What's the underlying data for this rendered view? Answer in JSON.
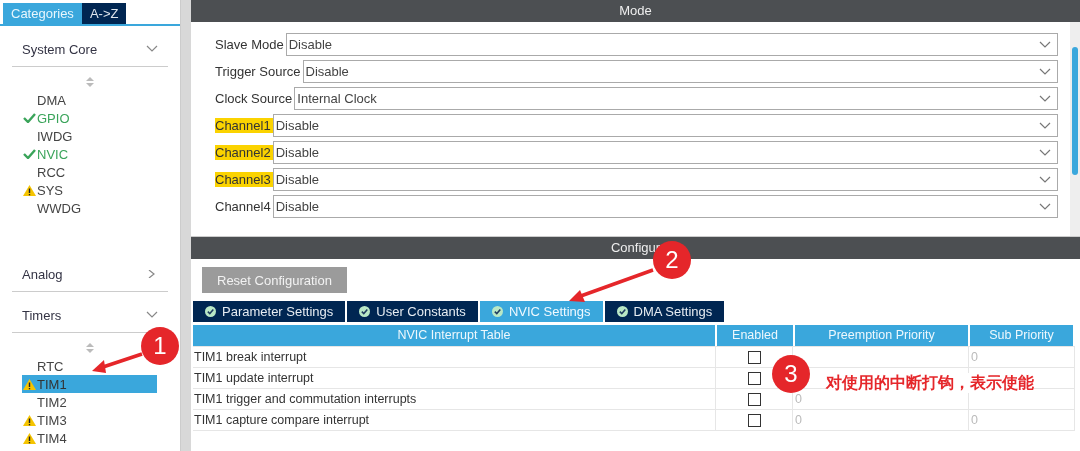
{
  "sidebar": {
    "tabs": [
      {
        "label": "Categories",
        "selected": true
      },
      {
        "label": "A->Z",
        "selected": false
      }
    ],
    "groups": [
      {
        "title": "System Core",
        "expanded": true,
        "items": [
          {
            "label": "DMA",
            "kind": "plain",
            "selected": false
          },
          {
            "label": "GPIO",
            "kind": "ok",
            "selected": false
          },
          {
            "label": "IWDG",
            "kind": "plain",
            "selected": false
          },
          {
            "label": "NVIC",
            "kind": "ok",
            "selected": false
          },
          {
            "label": "RCC",
            "kind": "plain",
            "selected": false
          },
          {
            "label": "SYS",
            "kind": "warning",
            "selected": false
          },
          {
            "label": "WWDG",
            "kind": "plain",
            "selected": false
          }
        ]
      },
      {
        "title": "Analog",
        "expanded": false
      },
      {
        "title": "Timers",
        "expanded": true,
        "items": [
          {
            "label": "RTC",
            "kind": "plain",
            "selected": false
          },
          {
            "label": "TIM1",
            "kind": "warning",
            "selected": true
          },
          {
            "label": "TIM2",
            "kind": "plain",
            "selected": false
          },
          {
            "label": "TIM3",
            "kind": "warning",
            "selected": false
          },
          {
            "label": "TIM4",
            "kind": "warning",
            "selected": false
          }
        ]
      }
    ]
  },
  "mode": {
    "title": "Mode",
    "rows": [
      {
        "label": "Slave Mode",
        "value": "Disable",
        "highlighted": false
      },
      {
        "label": "Trigger Source",
        "value": "Disable",
        "highlighted": false
      },
      {
        "label": "Clock Source",
        "value": "Internal Clock",
        "highlighted": false
      },
      {
        "label": "Channel1",
        "value": "Disable",
        "highlighted": true
      },
      {
        "label": "Channel2",
        "value": "Disable",
        "highlighted": true
      },
      {
        "label": "Channel3",
        "value": "Disable",
        "highlighted": true
      },
      {
        "label": "Channel4",
        "value": "Disable",
        "highlighted": false
      }
    ]
  },
  "configuration": {
    "title": "Configur",
    "reset_button": "Reset Configuration",
    "tabs": [
      {
        "label": "Parameter Settings",
        "selected": false
      },
      {
        "label": "User Constants",
        "selected": false
      },
      {
        "label": "NVIC Settings",
        "selected": true
      },
      {
        "label": "DMA Settings",
        "selected": false
      }
    ],
    "table": {
      "columns": [
        "NVIC Interrupt Table",
        "Enabled",
        "Preemption Priority",
        "Sub Priority"
      ],
      "rows": [
        {
          "name": "TIM1 break interrupt",
          "checked": false,
          "sub": "0"
        },
        {
          "name": "TIM1 update interrupt",
          "checked": false
        },
        {
          "name": "TIM1 trigger and commutation interrupts",
          "checked": false,
          "preemption": "0"
        },
        {
          "name": "TIM1 capture compare interrupt",
          "checked": false,
          "preemption": "0",
          "sub": "0"
        }
      ]
    }
  },
  "annotations": [
    {
      "number": "1"
    },
    {
      "number": "2"
    },
    {
      "number": "3",
      "note": "对使用的中断打钩，表示使能"
    }
  ]
}
